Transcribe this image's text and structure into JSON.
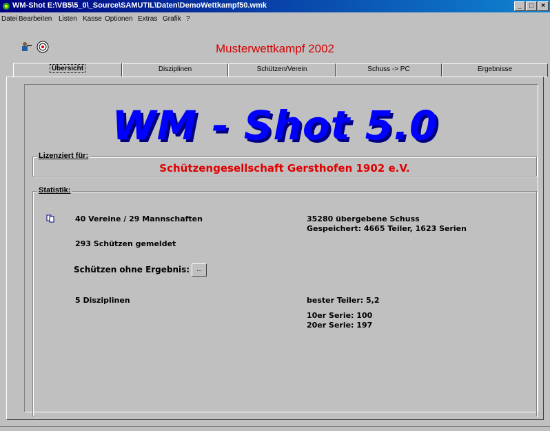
{
  "window": {
    "title": "WM-Shot E:\\VB5\\5_0\\_Source\\SAMUTIL\\Daten\\DemoWettkampf50.wmk",
    "minimize": "_",
    "maximize": "□",
    "close": "×"
  },
  "menu": [
    "Datei",
    "Bearbeiten",
    "Listen",
    "Kasse",
    "Optionen",
    "Extras",
    "Grafik",
    "?"
  ],
  "toolbar": {
    "event_title": "Musterwettkampf 2002",
    "icons": [
      "shooter-icon",
      "target-icon"
    ]
  },
  "tabs": [
    "Übersicht",
    "Disziplinen",
    "Schützen/Verein",
    "Schuss -> PC",
    "Ergebnisse"
  ],
  "logo": "WM - Shot 5.0",
  "license": {
    "legend": "Lizenziert für:",
    "club": "Schützengesellschaft Gersthofen 1902 e.V."
  },
  "stats": {
    "legend": "Statistik:",
    "clubs_teams": "40 Vereine  / 29 Mannschaften",
    "shooters": "293 Schützen gemeldet",
    "without_result_label": "Schützen ohne Ergebnis:",
    "without_result_button": "...",
    "disciplines": "5 Disziplinen",
    "shots": "35280 übergebene Schuss",
    "saved": "Gespeichert: 4665 Teiler, 1623 Serien",
    "best_teiler": "bester Teiler: 5,2",
    "series10": "10er Serie: 100",
    "series20": "20er Serie: 197"
  },
  "colors": {
    "title_bar": "#000080",
    "logo": "#0000ff",
    "event_title": "#d40000",
    "club_name": "#e00000",
    "background": "#c0c0c0"
  }
}
